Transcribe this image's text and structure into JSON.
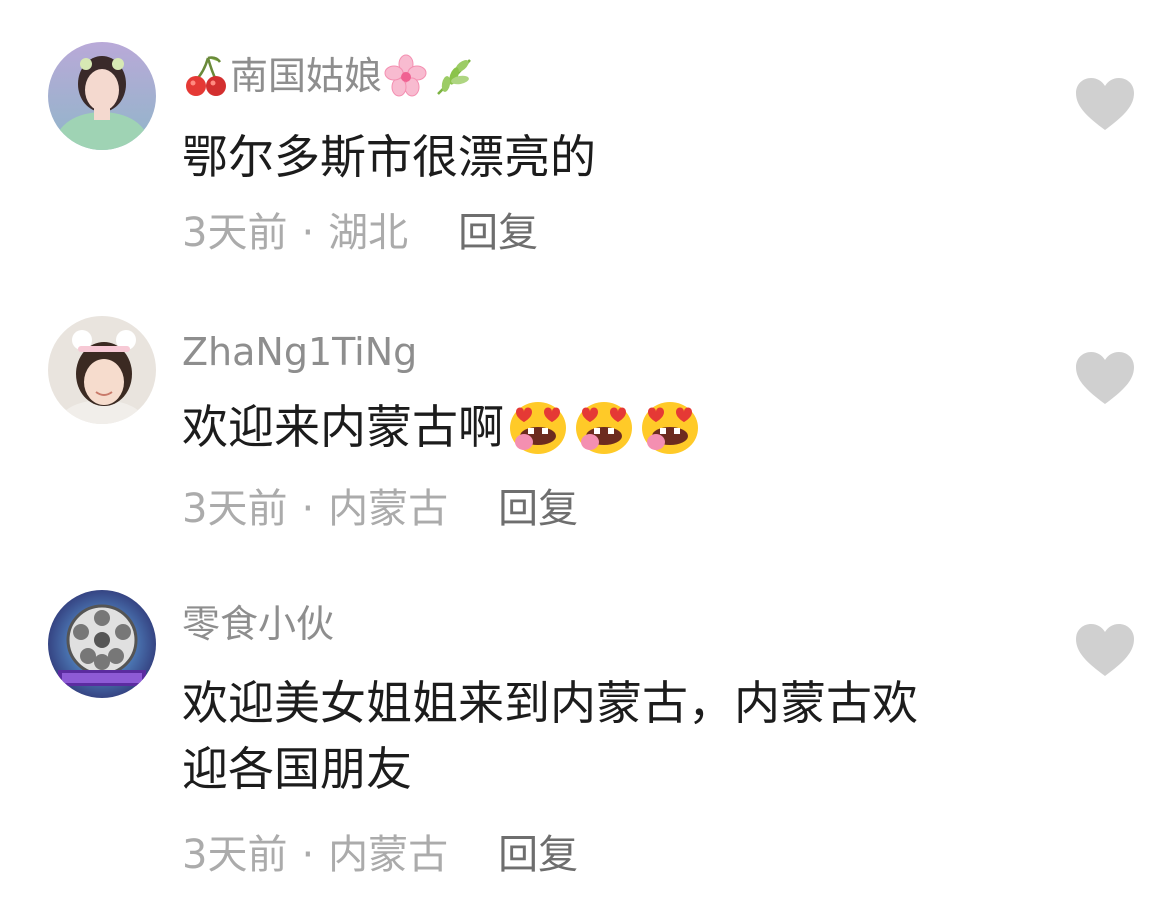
{
  "comments": [
    {
      "username": "南国姑娘",
      "username_prefix_icon": "cherries-emoji",
      "username_suffix_icons": [
        "cherry-blossom-emoji",
        "herb-emoji"
      ],
      "text": "鄂尔多斯市很漂亮的",
      "time": "3天前",
      "location": "湖北",
      "reply_label": "回复"
    },
    {
      "username": "ZhaNg1TiNg",
      "text": "欢迎来内蒙古啊",
      "text_emojis": [
        "heart-eyes-tongue-face",
        "heart-eyes-tongue-face",
        "heart-eyes-tongue-face"
      ],
      "time": "3天前",
      "location": "内蒙古",
      "reply_label": "回复"
    },
    {
      "username": "零食小伙",
      "text_line1": "欢迎美女姐姐来到内蒙古，内蒙古欢",
      "text_line2": "迎各国朋友",
      "time": "3天前",
      "location": "内蒙古",
      "reply_label": "回复"
    }
  ],
  "separator": "·",
  "colors": {
    "username": "#8e8e8e",
    "text": "#1c1c1c",
    "meta": "#ababab",
    "reply": "#6e6e6e",
    "like_icon": "#d0d0d0"
  }
}
